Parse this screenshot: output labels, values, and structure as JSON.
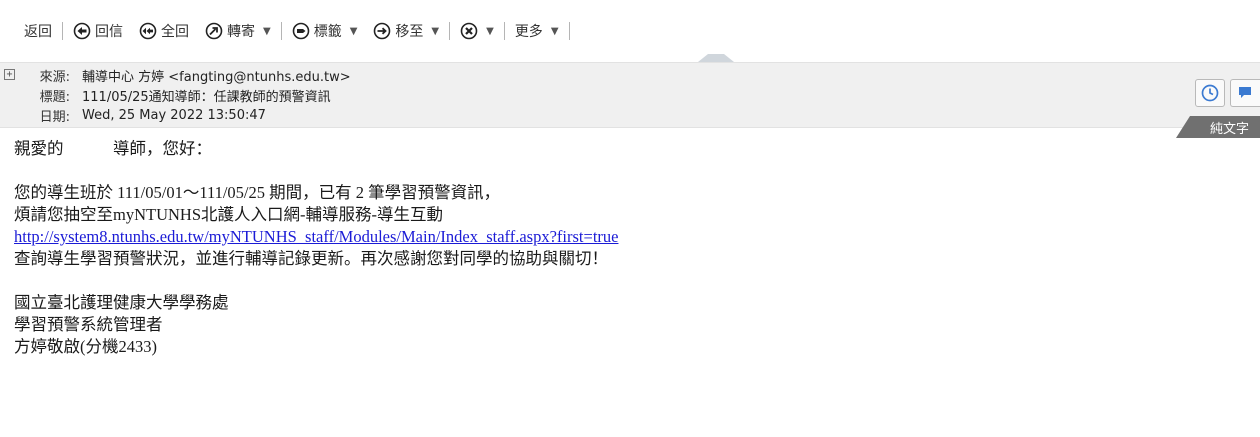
{
  "toolbar": {
    "back": "返回",
    "reply": "回信",
    "reply_all": "全回",
    "forward": "轉寄",
    "tag": "標籤",
    "move_to": "移至",
    "more": "更多"
  },
  "header": {
    "from_label": "來源:",
    "from_value": "輔導中心 方婷 <fangting@ntunhs.edu.tw>",
    "subject_label": "標題:",
    "subject_value": "111/05/25通知導師：任課教師的預警資訊",
    "date_label": "日期:",
    "date_value": "Wed, 25 May 2022 13:50:47",
    "plain_text_tab": "純文字"
  },
  "message": {
    "greeting": "親愛的　　　導師，您好：",
    "para1_line1": "您的導生班於 111/05/01～111/05/25 期間，已有 2 筆學習預警資訊，",
    "para1_line2": "煩請您抽空至myNTUNHS北護人入口網-輔導服務-導生互動",
    "link": "http://system8.ntunhs.edu.tw/myNTUNHS_staff/Modules/Main/Index_staff.aspx?first=true",
    "para1_line4": "查詢導生學習預警狀況，並進行輔導記錄更新。再次感謝您對同學的協助與關切！",
    "sign1": "國立臺北護理健康大學學務處",
    "sign2": "學習預警系統管理者",
    "sign3": "方婷敬啟(分機2433)"
  },
  "colors": {
    "link": "#1b1bd6",
    "header_bg": "#f0f0f0",
    "tab_bg": "#707070",
    "clock_icon": "#3b7ad1",
    "chat_icon": "#3b7ad1"
  }
}
